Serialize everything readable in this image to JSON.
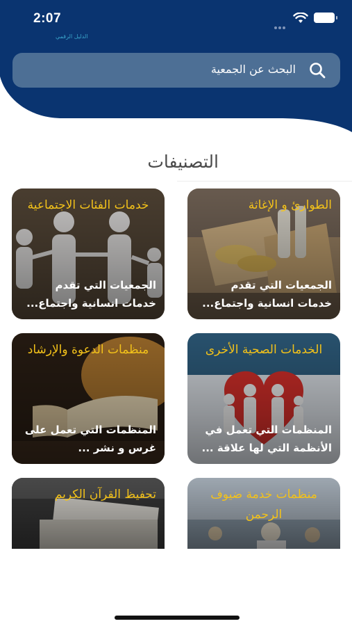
{
  "status": {
    "time": "2:07"
  },
  "app": {
    "logo_text": "الدليل الرقمي"
  },
  "search": {
    "placeholder": "البحث عن الجمعية"
  },
  "section": {
    "title": "التصنيفات"
  },
  "categories": [
    {
      "title": "الطوارئ و الإغاثة",
      "description": "الجمعيات التي تقدم خدمات انسانية واجتماع..."
    },
    {
      "title": "خدمات الفئات الاجتماعية",
      "description": "الجمعيات التي تقدم خدمات انسانية واجتماع..."
    },
    {
      "title": "الخدمات الصحية الأخرى",
      "description": "المنظمات التي تعمل في الأنظمة التي لها علاقة ..."
    },
    {
      "title": "منظمات الدعوة والإرشاد",
      "description": "المنظمات التي تعمل على غرس و نشر ..."
    },
    {
      "title": "منظمات خدمة ضيوف الرحمن",
      "description": ""
    },
    {
      "title": "تحفيظ القرآن الكريم",
      "description": ""
    }
  ],
  "colors": {
    "header": "#0a3470",
    "search_bg": "#4d6f95",
    "accent_title": "#f3c21a"
  }
}
